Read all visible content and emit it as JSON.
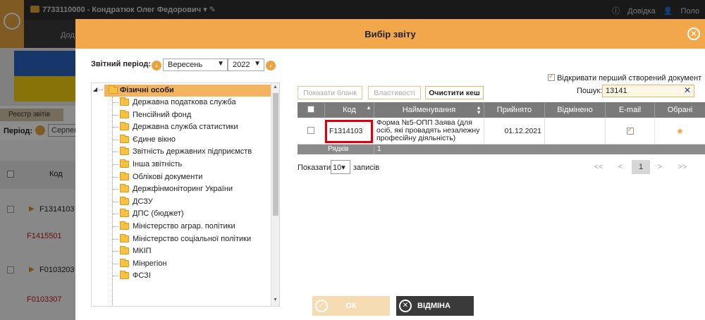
{
  "app": {
    "user_title": "7733110000 - Кондратюк Олег Федорович",
    "help_label": "Довідка",
    "user_menu_label": "Поло",
    "add_label": "Дод",
    "registry_tab": "Реєстр звітів",
    "period_label": "Період:",
    "period_value": "Серпен",
    "bg_table": {
      "code_header": "Код",
      "rows": [
        {
          "code": "F1314103",
          "red": false
        },
        {
          "code": "F1415501",
          "red": true
        },
        {
          "code": "F0103203",
          "red": false
        },
        {
          "code": "F0103307",
          "red": true
        }
      ]
    }
  },
  "modal": {
    "title": "Вибір звіту",
    "period_label": "Звітний період:",
    "month": "Вересень",
    "year": "2022",
    "tree": {
      "root": "Фізичні особи",
      "items": [
        "Державна податкова служба",
        "Пенсійний фонд",
        "Державна служба статистики",
        "Єдине вікно",
        "Звітність державних підприємств",
        "Інша звітність",
        "Облікові документи",
        "Держфінмоніторинг України",
        "ДСЗУ",
        "ДПС (бюджет)",
        "Міністерство аграр. політики",
        "Міністерство соціальної політики",
        "МКІП",
        "Мінрегіон",
        "ФСЗІ"
      ]
    },
    "open_first_label": "Відкривати перший створений документ",
    "search_label": "Пошук:",
    "search_value": "13141",
    "buttons": {
      "show_form": "Показати бланк",
      "properties": "Властивості",
      "clear_cache": "Очистити кеш",
      "ok": "ОК",
      "cancel": "ВІДМІНА"
    },
    "grid": {
      "headers": {
        "code": "Код",
        "name": "Найменування",
        "accepted": "Прийнято",
        "cancelled": "Відмінено",
        "email": "E-mail",
        "favorites": "Обрані"
      },
      "rows": [
        {
          "code": "F1314103",
          "name": "Форма №5-ОПП Заява (для осіб, які провадять незалежну професійну діяльність)",
          "accepted": "01.12.2021",
          "cancelled": ""
        }
      ],
      "footer_label": "Рядків",
      "footer_count": "1"
    },
    "paging": {
      "show_label": "Показати",
      "page_size": "10",
      "records_label": "записів",
      "first": "<<",
      "prev": "<",
      "current": "1",
      "next": ">",
      "last": ">>"
    }
  }
}
